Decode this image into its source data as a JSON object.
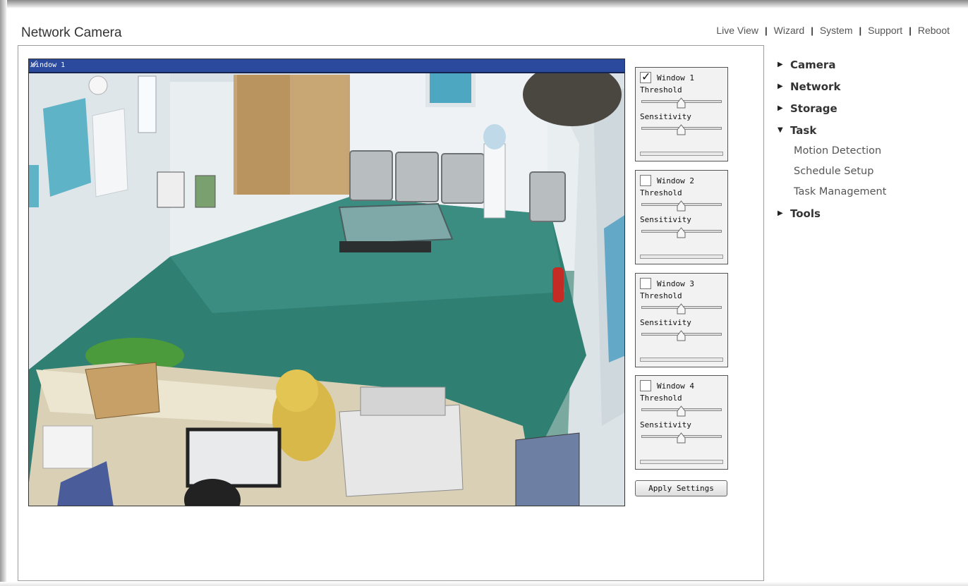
{
  "app": {
    "title": "Network Camera"
  },
  "topnav": {
    "items": [
      "Live View",
      "Wizard",
      "System",
      "Support",
      "Reboot"
    ],
    "separator": "|"
  },
  "camera": {
    "overlay_label": "Window 1"
  },
  "motion_windows": [
    {
      "label": "Window 1",
      "checked": true,
      "threshold_label": "Threshold",
      "sensitivity_label": "Sensitivity",
      "threshold": 0.5,
      "sensitivity": 0.5
    },
    {
      "label": "Window 2",
      "checked": false,
      "threshold_label": "Threshold",
      "sensitivity_label": "Sensitivity",
      "threshold": 0.5,
      "sensitivity": 0.5
    },
    {
      "label": "Window 3",
      "checked": false,
      "threshold_label": "Threshold",
      "sensitivity_label": "Sensitivity",
      "threshold": 0.5,
      "sensitivity": 0.5
    },
    {
      "label": "Window 4",
      "checked": false,
      "threshold_label": "Threshold",
      "sensitivity_label": "Sensitivity",
      "threshold": 0.5,
      "sensitivity": 0.5
    }
  ],
  "apply_label": "Apply Settings",
  "menu": {
    "items": [
      {
        "label": "Camera",
        "icon": "caret-right-icon"
      },
      {
        "label": "Network",
        "icon": "caret-right-icon"
      },
      {
        "label": "Storage",
        "icon": "caret-right-icon"
      },
      {
        "label": "Task",
        "icon": "caret-down-icon"
      },
      {
        "label": "Tools",
        "icon": "caret-right-icon"
      }
    ],
    "task_subitems": [
      "Motion Detection",
      "Schedule Setup",
      "Task Management"
    ]
  },
  "colors": {
    "overlay_bar": "#2b4a9e",
    "floor": "#2f7f73",
    "text": "#333333"
  }
}
